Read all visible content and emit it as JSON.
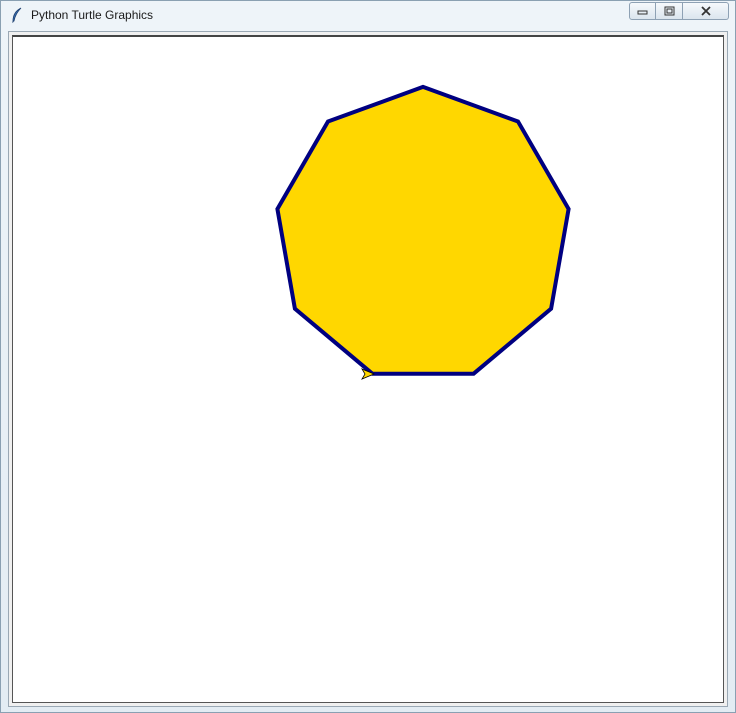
{
  "window": {
    "title": "Python Turtle Graphics"
  },
  "icons": {
    "app": "feather-icon",
    "minimize": "minimize-icon",
    "maximize": "maximize-icon",
    "close": "close-icon"
  },
  "drawing": {
    "shape": "nonagon",
    "sides": 9,
    "fill_color": "#FFD700",
    "pen_color": "#000080",
    "turtle_color": "#FFD700"
  }
}
